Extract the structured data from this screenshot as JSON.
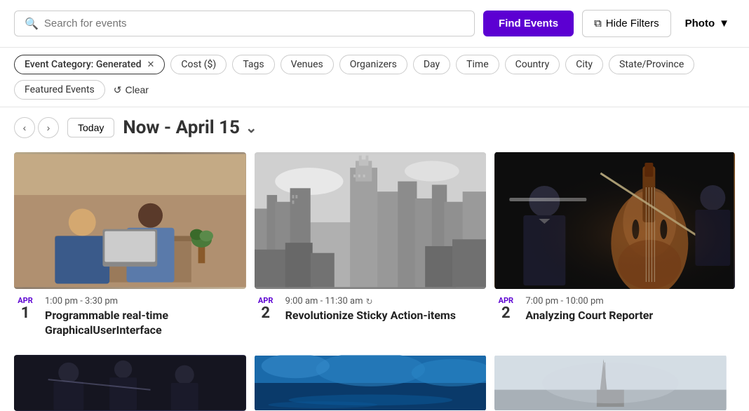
{
  "search": {
    "placeholder": "Search for events",
    "find_label": "Find Events",
    "hide_filters_label": "Hide Filters",
    "photo_label": "Photo"
  },
  "filters": {
    "active_chip": "Event Category: Generated",
    "chips": [
      "Cost ($)",
      "Tags",
      "Venues",
      "Organizers",
      "Day",
      "Time",
      "Country",
      "City",
      "State/Province",
      "Featured Events"
    ],
    "clear_label": "Clear"
  },
  "date_nav": {
    "today_label": "Today",
    "range": "Now - April 15"
  },
  "events": [
    {
      "month": "APR",
      "day": "1",
      "time": "1:00 pm - 3:30 pm",
      "title": "Programmable real-time GraphicalUserInterface",
      "image_class": "img-office",
      "repeat": false
    },
    {
      "month": "APR",
      "day": "2",
      "time": "9:00 am - 11:30 am",
      "title": "Revolutionize Sticky Action-items",
      "image_class": "img-city",
      "repeat": true
    },
    {
      "month": "APR",
      "day": "2",
      "time": "7:00 pm - 10:00 pm",
      "title": "Analyzing Court Reporter",
      "image_class": "img-orchestra",
      "repeat": false
    }
  ],
  "bottom_events": [
    {
      "image_class": "img-bottom1"
    },
    {
      "image_class": "img-bottom2"
    },
    {
      "image_class": "img-bottom3"
    }
  ]
}
